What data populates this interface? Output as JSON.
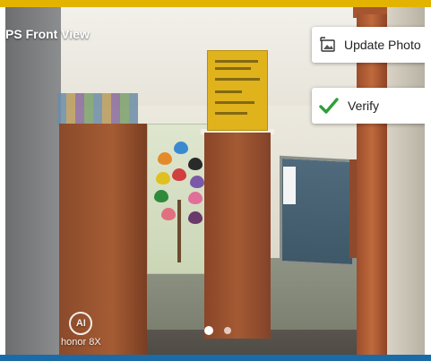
{
  "photo": {
    "title": "PS Front View",
    "watermark_line1": "AI",
    "watermark_line2": "honor 8X"
  },
  "actions": {
    "update_photo_label": "Update Photo",
    "verify_label": "Verify"
  },
  "carousel": {
    "count": 2,
    "active_index": 0
  },
  "colors": {
    "accent_top": "#e2b400",
    "accent_bottom": "#1a6ca8",
    "verify_check": "#2e9e3a"
  },
  "icons": {
    "update_photo": "photo-edit-icon",
    "verify": "checkmark-icon"
  }
}
